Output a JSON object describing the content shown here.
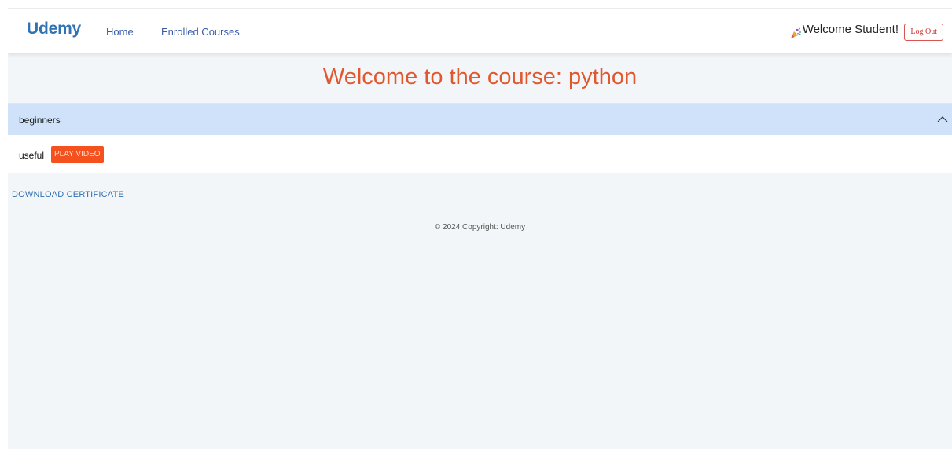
{
  "navbar": {
    "brand": "Udemy",
    "links": [
      {
        "label": "Home"
      },
      {
        "label": "Enrolled Courses"
      }
    ],
    "welcome_text": "Welcome Student!",
    "logout_label": "Log Out",
    "welcome_icon": "party-popper-icon"
  },
  "main": {
    "title": "Welcome to the course: python"
  },
  "accordion": {
    "section_label": "beginners",
    "expanded": true,
    "lessons": [
      {
        "name": "useful",
        "button_label": "PLAY VIDEO"
      }
    ]
  },
  "actions": {
    "download_label": "DOWNLOAD CERTIFICATE"
  },
  "footer": {
    "copyright": "© 2024 Copyright: Udemy"
  },
  "colors": {
    "brand": "#2f72b5",
    "title": "#e0592e",
    "accordion_header": "#cfe2fa",
    "play_button": "#f4511e",
    "logout_border": "#d9534f",
    "page_background": "#f3f6f9"
  }
}
